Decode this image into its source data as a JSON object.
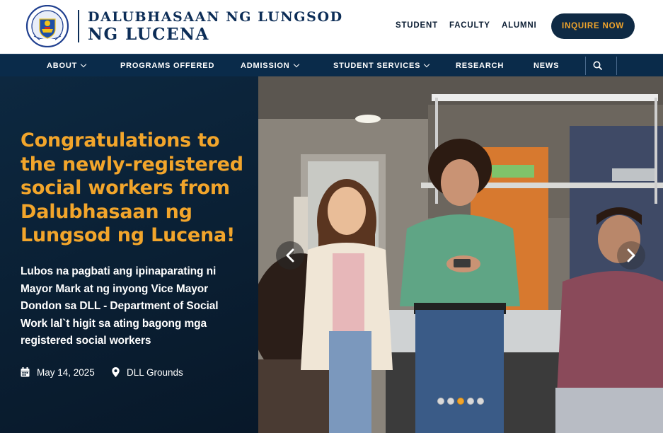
{
  "brand": {
    "name_line1": "DALUBHASAAN NG LUNGSOD",
    "name_line2": "NG LUCENA",
    "seal_text": "DALUBHASAAN NG LUNGSOD NG LUCENA",
    "seal_year": "2001"
  },
  "top_links": [
    "STUDENT",
    "FACULTY",
    "ALUMNI"
  ],
  "cta": {
    "label": "INQUIRE NOW"
  },
  "nav": [
    {
      "label": "ABOUT",
      "dropdown": true
    },
    {
      "label": "PROGRAMS OFFERED",
      "dropdown": false
    },
    {
      "label": "ADMISSION",
      "dropdown": true
    },
    {
      "label": "STUDENT SERVICES",
      "dropdown": true
    },
    {
      "label": "RESEARCH",
      "dropdown": false
    },
    {
      "label": "NEWS",
      "dropdown": false
    }
  ],
  "search": {
    "icon": "search-icon"
  },
  "hero": {
    "title": "Congratulations to the newly-registered social workers from Dalubhasaan ng Lungsod ng Lucena!",
    "description": "Lubos na pagbati ang ipinaparating ni Mayor Mark at ng inyong Vice Mayor Dondon sa DLL - Department of Social Work lal`t higit sa ating bagong mga registered social workers",
    "date": "May 14, 2025",
    "location": "DLL Grounds",
    "date_icon": "calendar-icon",
    "location_icon": "map-pin-icon"
  },
  "carousel": {
    "slide_count": 5,
    "active_index": 2,
    "prev_icon": "chevron-left-icon",
    "next_icon": "chevron-right-icon"
  },
  "colors": {
    "navy": "#0c2d57",
    "nav_bg": "#0a2b4a",
    "accent": "#f2a52b",
    "hero_bg": "#0a1f33"
  }
}
